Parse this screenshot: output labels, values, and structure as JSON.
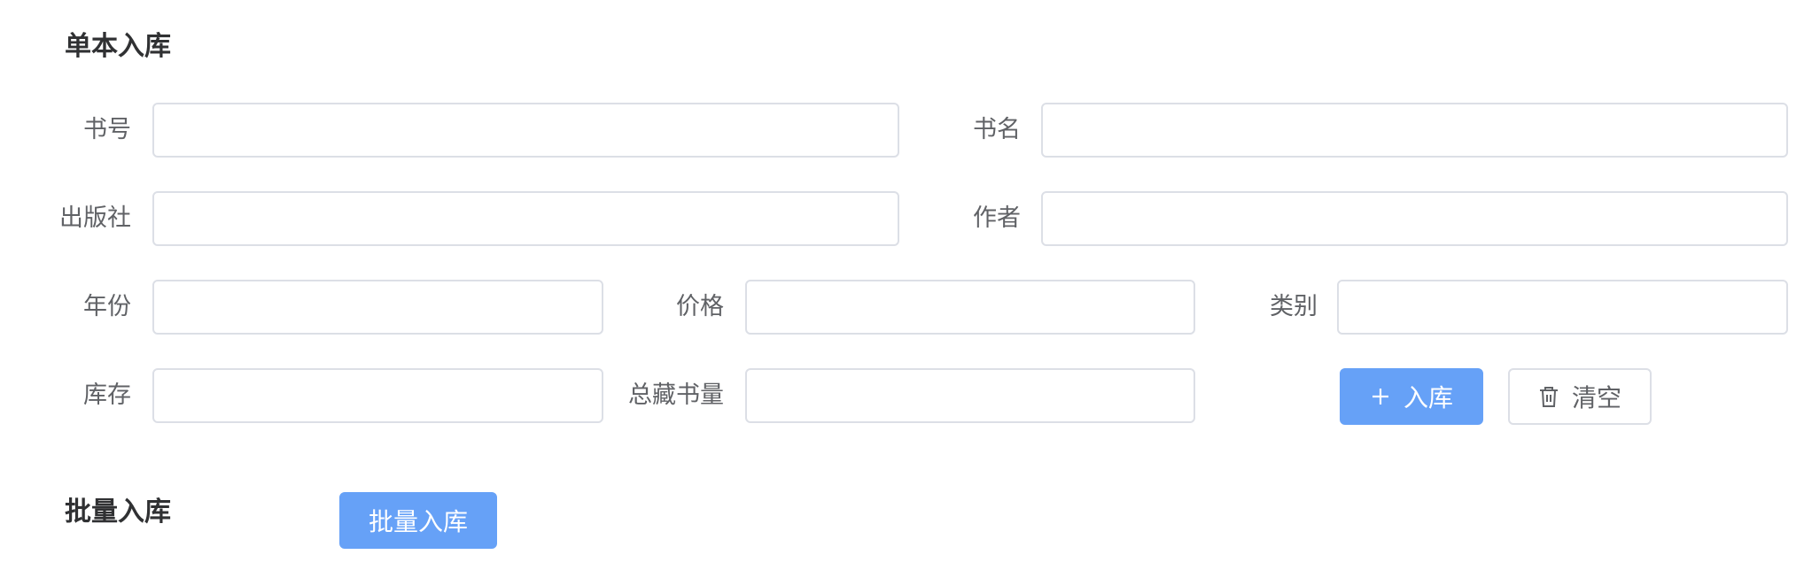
{
  "single_section": {
    "title": "单本入库",
    "fields": {
      "book_id": {
        "label": "书号",
        "value": "",
        "placeholder": ""
      },
      "book_name": {
        "label": "书名",
        "value": "",
        "placeholder": ""
      },
      "publisher": {
        "label": "出版社",
        "value": "",
        "placeholder": ""
      },
      "author": {
        "label": "作者",
        "value": "",
        "placeholder": ""
      },
      "year": {
        "label": "年份",
        "value": "",
        "placeholder": ""
      },
      "price": {
        "label": "价格",
        "value": "",
        "placeholder": ""
      },
      "category": {
        "label": "类别",
        "value": "",
        "placeholder": ""
      },
      "stock": {
        "label": "库存",
        "value": "",
        "placeholder": ""
      },
      "total": {
        "label": "总藏书量",
        "value": "",
        "placeholder": ""
      }
    },
    "buttons": {
      "submit_label": "入库",
      "submit_icon": "plus-icon",
      "clear_label": "清空",
      "clear_icon": "trash-icon"
    }
  },
  "batch_section": {
    "title": "批量入库",
    "button_label": "批量入库"
  },
  "colors": {
    "primary": "#66a1f7",
    "border": "#dcdfe6",
    "label_text": "#606266",
    "title_text": "#303133"
  }
}
